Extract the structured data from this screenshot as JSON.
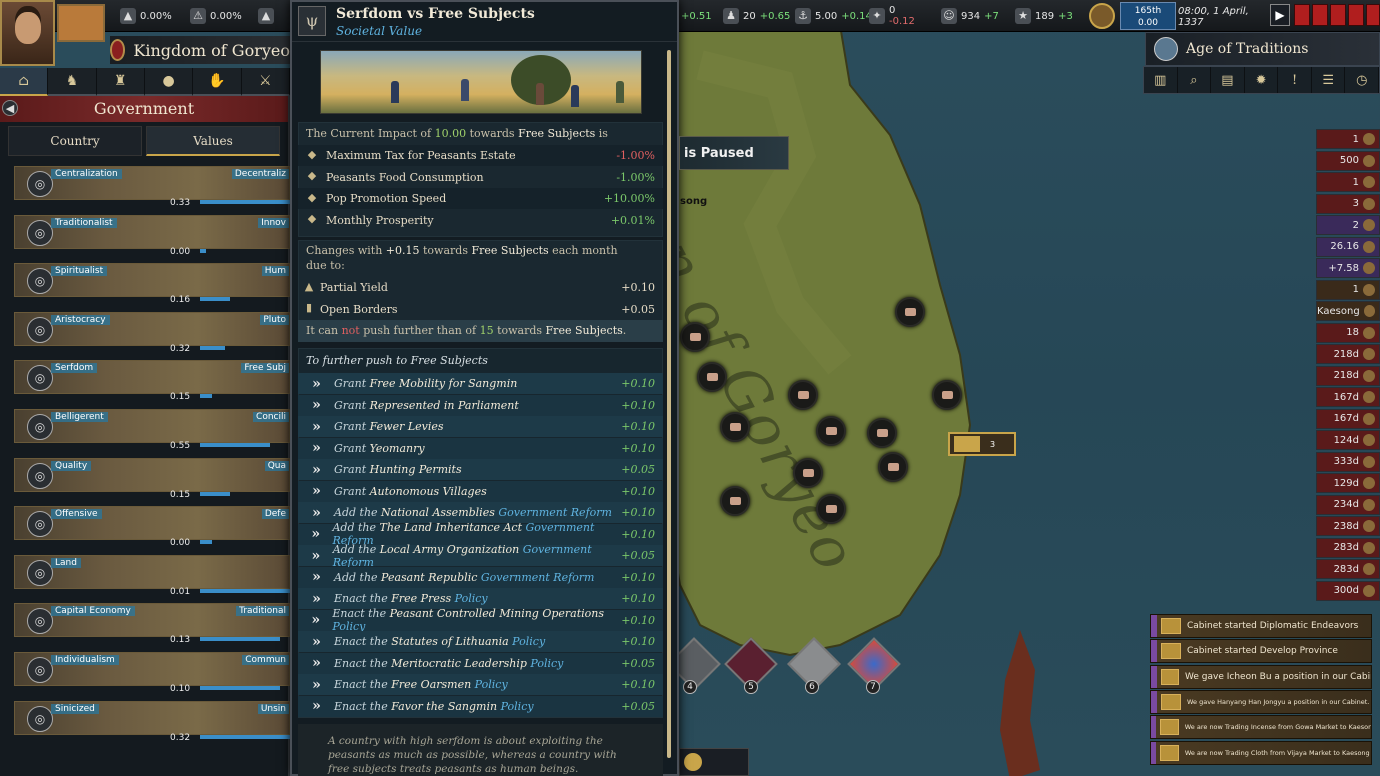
{
  "topbar": {
    "stats_left": [
      {
        "icon": "estate-icon",
        "value": "0.00%"
      },
      {
        "icon": "warning-icon",
        "value": "0.00%"
      }
    ],
    "stats_right": [
      {
        "value": "+0.51"
      },
      {
        "value": "20",
        "delta": "+0.65"
      },
      {
        "value": "5.00",
        "delta": "+0.14"
      },
      {
        "value": "0",
        "delta": "-0.12"
      },
      {
        "value": "934",
        "delta": "+7"
      },
      {
        "value": "189",
        "delta": "+3"
      }
    ],
    "clock_rank": "165th",
    "clock_value": "0.00",
    "date": "08:00, 1 April, 1337"
  },
  "country": {
    "name": "Kingdom of Goryeo"
  },
  "nav_tabs": [
    "house-icon",
    "helmet-icon",
    "building-icon",
    "coins-icon",
    "hand-icon",
    "swords-icon"
  ],
  "government": {
    "title": "Government",
    "tabs": [
      "Country",
      "Values"
    ],
    "values": [
      {
        "name": "Centralization",
        "right": "Decentraliz",
        "num": "0.33"
      },
      {
        "name": "Traditionalist",
        "right": "Innov",
        "num": "0.00"
      },
      {
        "name": "Spiritualist",
        "right": "Hum",
        "num": "0.16"
      },
      {
        "name": "Aristocracy",
        "right": "Pluto",
        "num": "0.32"
      },
      {
        "name": "Serfdom",
        "right": "Free Subj",
        "num": "0.15"
      },
      {
        "name": "Belligerent",
        "right": "Concili",
        "num": "0.55"
      },
      {
        "name": "Quality",
        "right": "Qua",
        "num": "0.15"
      },
      {
        "name": "Offensive",
        "right": "Defe",
        "num": "0.00"
      },
      {
        "name": "Land",
        "right": "",
        "num": "0.01"
      },
      {
        "name": "Capital Economy",
        "right": "Traditional",
        "num": "0.13"
      },
      {
        "name": "Individualism",
        "right": "Commun",
        "num": "0.10"
      },
      {
        "name": "Sinicized",
        "right": "Unsin",
        "num": "0.32"
      }
    ]
  },
  "tooltip": {
    "title": "Serfdom vs Free Subjects",
    "subtitle": "Societal Value",
    "impact_pre": "The Current Impact of ",
    "impact_val": "10.00",
    "impact_mid": " towards ",
    "impact_target": "Free Subjects",
    "impact_post": " is",
    "modifiers": [
      {
        "label": "Maximum Tax for Peasants Estate",
        "value": "-1.00%",
        "neg": true
      },
      {
        "label": "Peasants Food Consumption",
        "value": "-1.00%",
        "neg": false
      },
      {
        "label": "Pop Promotion Speed",
        "value": "+10.00%",
        "neg": false
      },
      {
        "label": "Monthly Prosperity",
        "value": "+0.01%",
        "neg": false
      }
    ],
    "changes_pre": "Changes with ",
    "changes_val": "+0.15",
    "changes_mid": " towards ",
    "changes_target": "Free Subjects",
    "changes_post": " each month",
    "changes_due": "due to:",
    "sources": [
      {
        "label": "Partial Yield",
        "value": "+0.10"
      },
      {
        "label": "Open Borders",
        "value": "+0.05"
      }
    ],
    "limit_pre": "It can ",
    "limit_not": "not",
    "limit_mid": " push further than of ",
    "limit_val": "15",
    "limit_mid2": " towards ",
    "limit_target": "Free Subjects",
    "limit_post": ".",
    "push_header": "To further push to Free Subjects",
    "push_items": [
      {
        "verb": "Grant ",
        "name": "Free Mobility for Sangmin",
        "kind": "",
        "value": "+0.10"
      },
      {
        "verb": "Grant ",
        "name": "Represented in Parliament",
        "kind": "",
        "value": "+0.10"
      },
      {
        "verb": "Grant ",
        "name": "Fewer Levies",
        "kind": "",
        "value": "+0.10"
      },
      {
        "verb": "Grant ",
        "name": "Yeomanry",
        "kind": "",
        "value": "+0.10"
      },
      {
        "verb": "Grant ",
        "name": "Hunting Permits",
        "kind": "",
        "value": "+0.05"
      },
      {
        "verb": "Grant ",
        "name": "Autonomous Villages",
        "kind": "",
        "value": "+0.10"
      },
      {
        "verb": "Add the ",
        "name": "National Assemblies",
        "kind": " Government Reform",
        "value": "+0.10"
      },
      {
        "verb": "Add the ",
        "name": "The Land Inheritance Act",
        "kind": " Government Reform",
        "value": "+0.10"
      },
      {
        "verb": "Add the ",
        "name": "Local Army Organization",
        "kind": " Government Reform",
        "value": "+0.05"
      },
      {
        "verb": "Add the ",
        "name": "Peasant Republic",
        "kind": " Government Reform",
        "value": "+0.10"
      },
      {
        "verb": "Enact the ",
        "name": "Free Press",
        "kind": " Policy",
        "value": "+0.10"
      },
      {
        "verb": "Enact the ",
        "name": "Peasant Controlled Mining Operations",
        "kind": " Policy",
        "value": "+0.10"
      },
      {
        "verb": "Enact the ",
        "name": "Statutes of Lithuania",
        "kind": " Policy",
        "value": "+0.10"
      },
      {
        "verb": "Enact the ",
        "name": "Meritocratic Leadership",
        "kind": " Policy",
        "value": "+0.05"
      },
      {
        "verb": "Enact the ",
        "name": "Free Oarsmen",
        "kind": " Policy",
        "value": "+0.10"
      },
      {
        "verb": "Enact the ",
        "name": "Favor the Sangmin",
        "kind": " Policy",
        "value": "+0.05"
      }
    ],
    "description": "A country with high serfdom is about exploiting the peasants as much as possible, whereas a country with free subjects treats peasants as human beings."
  },
  "age": {
    "title": "Age of Traditions"
  },
  "paused_text": "is Paused",
  "map": {
    "label": "n of Goryeo",
    "city_label": "song",
    "army_count": "3",
    "dip_nums": [
      "4",
      "5",
      "6",
      "7"
    ]
  },
  "right_column": [
    {
      "value": "1",
      "style": "red"
    },
    {
      "value": "500",
      "style": "red"
    },
    {
      "value": "1",
      "style": "red"
    },
    {
      "value": "3",
      "style": "red"
    },
    {
      "value": "2",
      "style": "purple"
    },
    {
      "value": "26.16",
      "style": "purple"
    },
    {
      "value": "+7.58",
      "style": "purple"
    },
    {
      "value": "1",
      "style": "brown"
    },
    {
      "value": "Kaesong",
      "style": "brown"
    },
    {
      "value": "18",
      "style": "red"
    },
    {
      "value": "218d",
      "style": "red"
    },
    {
      "value": "218d",
      "style": "red"
    },
    {
      "value": "167d",
      "style": "red"
    },
    {
      "value": "167d",
      "style": "red"
    },
    {
      "value": "124d",
      "style": "red"
    },
    {
      "value": "333d",
      "style": "red"
    },
    {
      "value": "129d",
      "style": "red"
    },
    {
      "value": "234d",
      "style": "red"
    },
    {
      "value": "238d",
      "style": "red"
    },
    {
      "value": "283d",
      "style": "red"
    },
    {
      "value": "283d",
      "style": "red"
    },
    {
      "value": "300d",
      "style": "red"
    }
  ],
  "notifications": [
    {
      "text": "Cabinet started Diplomatic Endeavors",
      "small": false
    },
    {
      "text": "Cabinet started Develop Province",
      "small": false
    },
    {
      "text": "We gave Icheon Bu a position in our Cabinet.",
      "small": false
    },
    {
      "text": "We gave Hanyang Han Jongyu a position in our Cabinet.",
      "small": true
    },
    {
      "text": "We are now Trading Incense from Gowa Market to Kaesong M...",
      "small": true
    },
    {
      "text": "We are now Trading Cloth from Vijaya Market to Kaesong Mar...",
      "small": true
    }
  ]
}
